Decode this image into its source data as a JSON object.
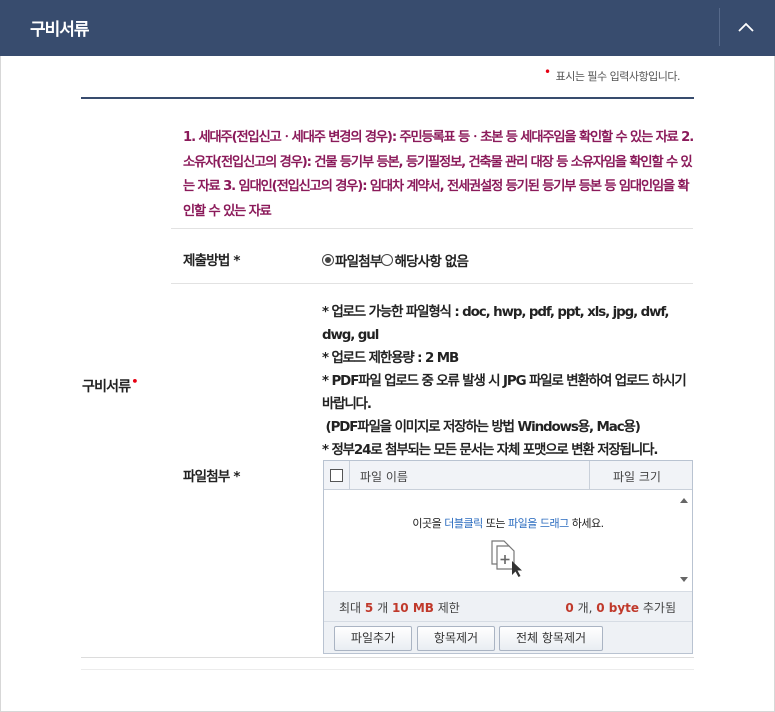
{
  "header": {
    "title": "구비서류",
    "toggle_icon": "chevron-up-icon"
  },
  "required_note": {
    "marker": "•",
    "text": "표시는 필수 입력사항입니다."
  },
  "row": {
    "label": "구비서류",
    "required_marker": "•"
  },
  "notice": "1. 세대주(전입신고ㆍ세대주 변경의 경우): 주민등록표 등ㆍ초본 등 세대주임을 확인할 수 있는 자료 2. 소유자(전입신고의 경우): 건물 등기부 등본, 등기필정보, 건축물 관리 대장 등 소유자임을 확인할 수 있는 자료 3. 임대인(전입신고의 경우): 임대차 계약서, 전세권설정 등기된 등기부 등본 등 임대인임을 확인할 수 있는 자료",
  "method": {
    "label": "제출방법 *",
    "options": [
      {
        "label": "파일첨부",
        "checked": true
      },
      {
        "label": "해당사항 없음",
        "checked": false
      }
    ]
  },
  "file_attach": {
    "label": "파일첨부 *",
    "guide": [
      "* 업로드 가능한 파일형식 : doc, hwp, pdf, ppt, xls, jpg, dwf, dwg, gul",
      "* 업로드 제한용량 : 2 MB",
      "* PDF파일 업로드 중 오류 발생 시 JPG 파일로 변환하여 업로드 하시기 바랍니다.",
      " (PDF파일을 이미지로 저장하는 방법 Windows용, Mac용)",
      "* 정부24로 첨부되는 모든 문서는 자체 포맷으로 변환 저장됩니다."
    ]
  },
  "uploader": {
    "col_name": "파일 이름",
    "col_size": "파일 크기",
    "msg_prefix": "이곳을 ",
    "msg_hl1": "더블클릭",
    "msg_mid": " 또는 ",
    "msg_hl2": "파일을 드래그",
    "msg_suffix": " 하세요.",
    "drop_icon": "file-add-icon",
    "status_prefix": "최대 ",
    "max_count": "5",
    "count_unit": " 개 ",
    "max_size": "10 MB",
    "limit_suffix": " 제한",
    "current_count": "0",
    "current_unit": " 개, ",
    "current_size": "0 byte",
    "added_suffix": " 추가됨",
    "buttons": {
      "add": "파일추가",
      "remove": "항목제거",
      "remove_all": "전체 항목제거"
    }
  }
}
